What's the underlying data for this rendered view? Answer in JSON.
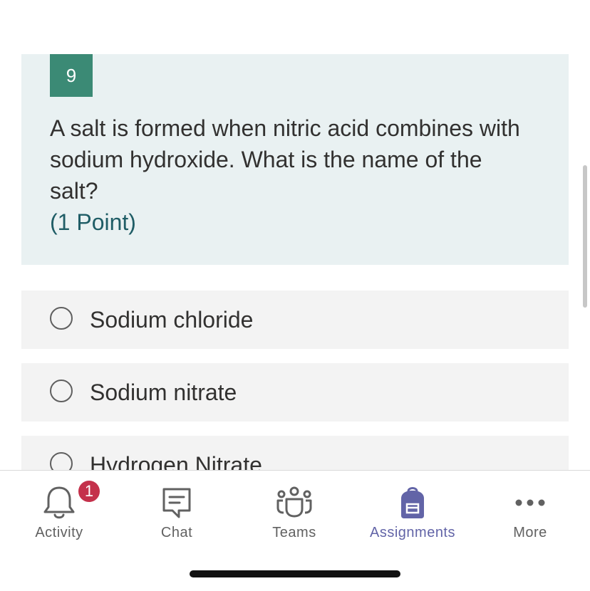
{
  "question": {
    "number": "9",
    "text": "A salt is formed when nitric acid combines with sodium hydroxide. What is the name of the salt?",
    "points": "(1 Point)"
  },
  "options": [
    {
      "label": "Sodium chloride",
      "selected": false
    },
    {
      "label": "Sodium nitrate",
      "selected": false
    },
    {
      "label": "Hydrogen Nitrate",
      "selected": false
    }
  ],
  "tabbar": {
    "tabs": [
      {
        "label": "Activity",
        "icon": "bell-icon",
        "badge": "1",
        "active": false
      },
      {
        "label": "Chat",
        "icon": "chat-icon",
        "active": false
      },
      {
        "label": "Teams",
        "icon": "teams-icon",
        "active": false
      },
      {
        "label": "Assignments",
        "icon": "backpack-icon",
        "active": true
      },
      {
        "label": "More",
        "icon": "more-icon",
        "active": false
      }
    ]
  },
  "colors": {
    "accent": "#6264a7",
    "question_number_bg": "#3b8a75",
    "question_card_bg": "#e9f1f2",
    "badge": "#c4314b"
  }
}
